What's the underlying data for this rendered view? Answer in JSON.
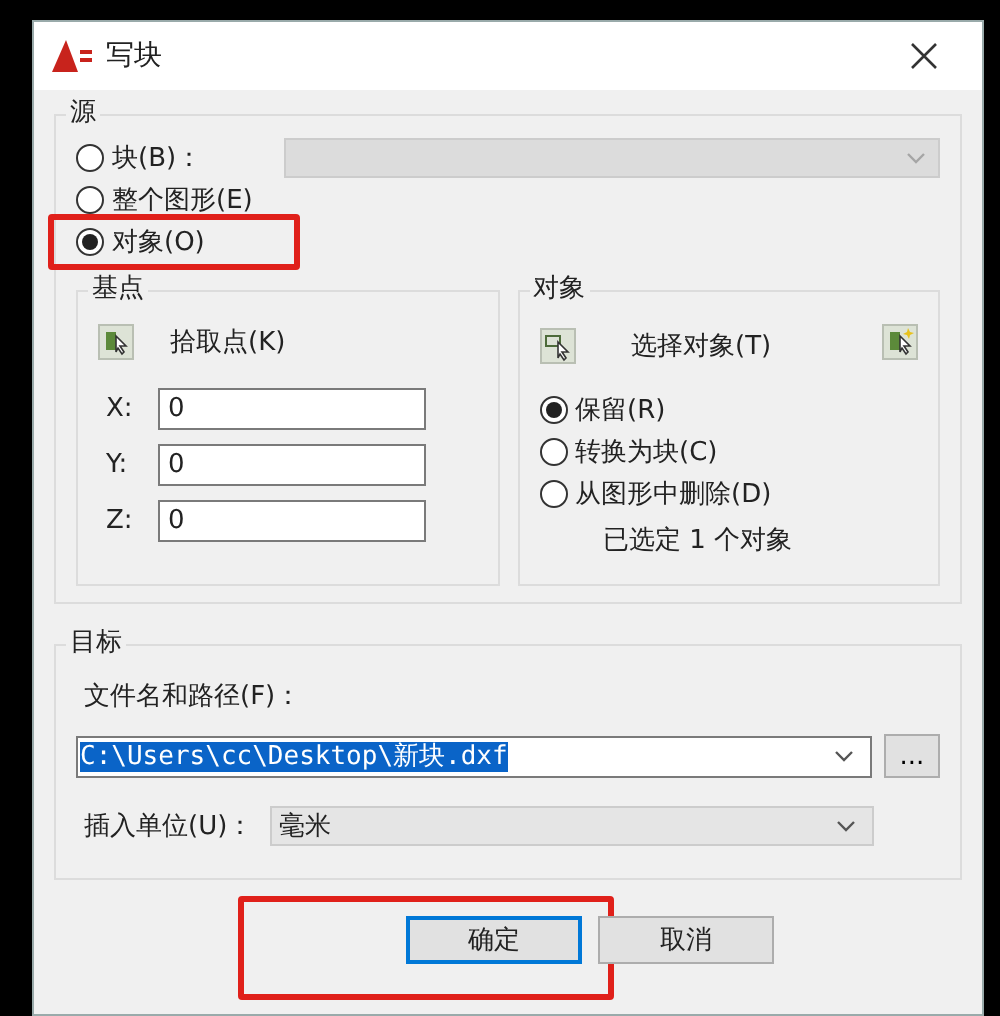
{
  "window": {
    "title": "写块"
  },
  "source": {
    "title": "源",
    "options": [
      {
        "label": "块(B)：",
        "selected": false,
        "highlighted": false
      },
      {
        "label": "整个图形(E)",
        "selected": false,
        "highlighted": false
      },
      {
        "label": "对象(O)",
        "selected": true,
        "highlighted": true
      }
    ],
    "block_dropdown": {
      "disabled": true
    }
  },
  "base_point": {
    "title": "基点",
    "pick_button": "拾取点(K)",
    "coords": [
      {
        "axis": "X:",
        "value": "0"
      },
      {
        "axis": "Y:",
        "value": "0"
      },
      {
        "axis": "Z:",
        "value": "0"
      }
    ]
  },
  "objects": {
    "title": "对象",
    "select_button": "选择对象(T)",
    "options": [
      {
        "label": "保留(R)",
        "selected": true
      },
      {
        "label": "转换为块(C)",
        "selected": false
      },
      {
        "label": "从图形中删除(D)",
        "selected": false
      }
    ],
    "status": "已选定 1 个对象"
  },
  "destination": {
    "title": "目标",
    "file_label": "文件名和路径(F)：",
    "file_path": "C:\\Users\\cc\\Desktop\\新块.dxf",
    "browse_button": "...",
    "units_label": "插入单位(U)：",
    "units": "毫米"
  },
  "buttons": [
    {
      "label": "确定",
      "default": true,
      "highlighted": true
    },
    {
      "label": "取消",
      "default": false,
      "highlighted": false
    }
  ]
}
